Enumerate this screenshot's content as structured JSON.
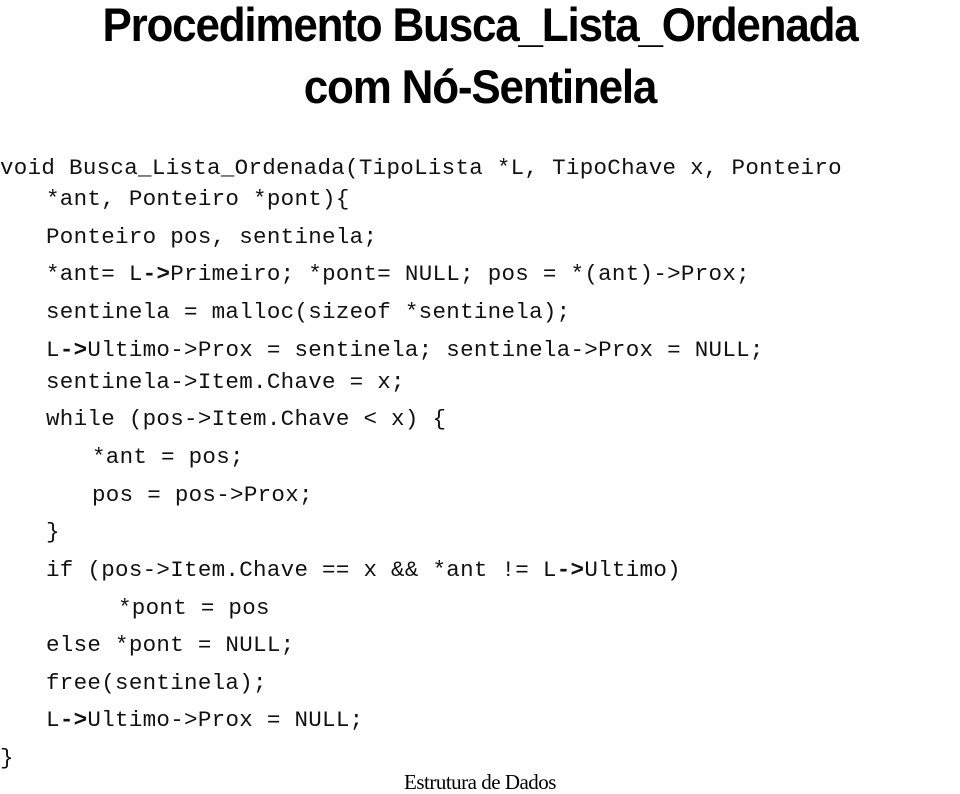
{
  "slide": {
    "title_line1": "Procedimento Busca_Lista_Ordenada",
    "title_line2": "com Nó-Sentinela",
    "footer": "Estrutura  de Dados"
  },
  "code": {
    "lines": [
      "void Busca_Lista_Ordenada(TipoLista *L, TipoChave x, Ponteiro",
      "*ant, Ponteiro *pont){",
      "Ponteiro pos, sentinela;",
      "*ant= L->Primeiro; *pont= NULL; pos = *(ant)->Prox;",
      "sentinela = malloc(sizeof *sentinela);",
      "L->Ultimo->Prox = sentinela; sentinela->Prox = NULL;",
      "sentinela->Item.Chave = x;",
      "while (pos->Item.Chave < x) {",
      "*ant = pos;",
      "pos = pos->Prox;",
      "}",
      "if (pos->Item.Chave == x && *ant != L->Ultimo)",
      "*pont = pos",
      "else *pont = NULL;",
      "free(sentinela);",
      "L->Ultimo->Prox = NULL;",
      "}"
    ]
  }
}
